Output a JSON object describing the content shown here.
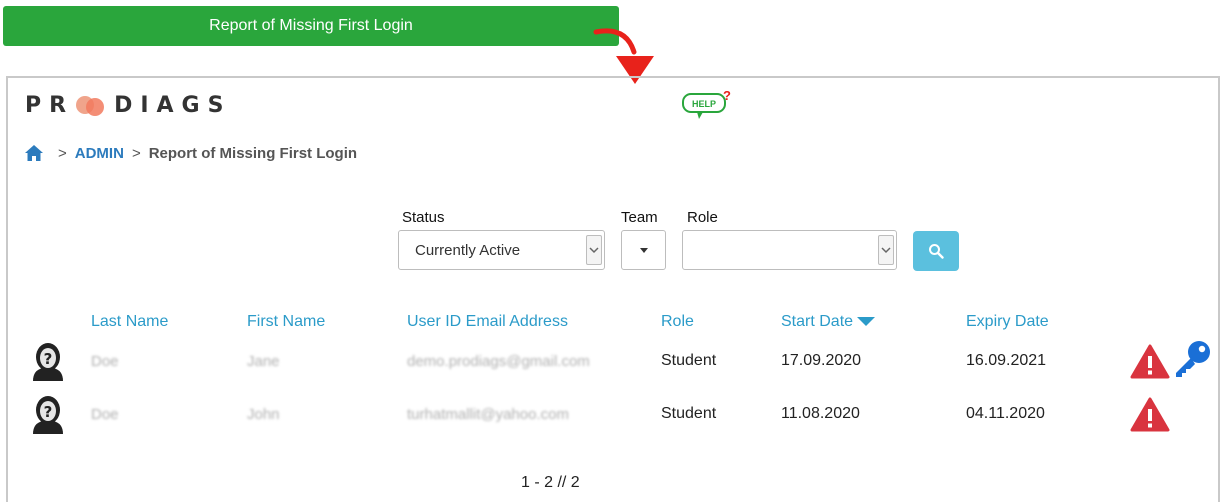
{
  "banner": {
    "title": "Report of Missing First Login"
  },
  "logo": {
    "text_left": "PR",
    "text_right": "DIAGS"
  },
  "help": {
    "label": "HELP",
    "mark": "?"
  },
  "breadcrumb": {
    "sep1": ">",
    "admin": "ADMIN",
    "sep2": ">",
    "current": "Report of Missing First Login"
  },
  "filters": {
    "status": {
      "label": "Status",
      "value": "Currently Active"
    },
    "team": {
      "label": "Team",
      "value": ""
    },
    "role": {
      "label": "Role",
      "value": ""
    }
  },
  "table": {
    "headers": {
      "last_name": "Last Name",
      "first_name": "First Name",
      "email": "User ID Email Address",
      "role": "Role",
      "start_date": "Start Date",
      "expiry_date": "Expiry Date"
    },
    "rows": [
      {
        "last_name": "Doe",
        "first_name": "Jane",
        "email": "demo.prodiags@gmail.com",
        "role": "Student",
        "start_date": "17.09.2020",
        "expiry_date": "16.09.2021"
      },
      {
        "last_name": "Doe",
        "first_name": "John",
        "email": "turhatmallit@yahoo.com",
        "role": "Student",
        "start_date": "11.08.2020",
        "expiry_date": "04.11.2020"
      }
    ]
  },
  "pager": {
    "text": "1 - 2 // 2"
  },
  "colors": {
    "banner": "#2aa63c",
    "link": "#2b9bc9",
    "admin": "#2c7bbd",
    "search": "#5bc0de",
    "warn": "#d9343f",
    "key": "#1a6fd6",
    "arrow": "#e8221b"
  },
  "icons": [
    "red-curved-arrow-icon",
    "help-bubble-icon",
    "home-icon",
    "chevron-down-icon",
    "caret-down-icon",
    "search-icon",
    "sort-desc-icon",
    "user-avatar-icon",
    "warning-icon",
    "key-icon"
  ]
}
